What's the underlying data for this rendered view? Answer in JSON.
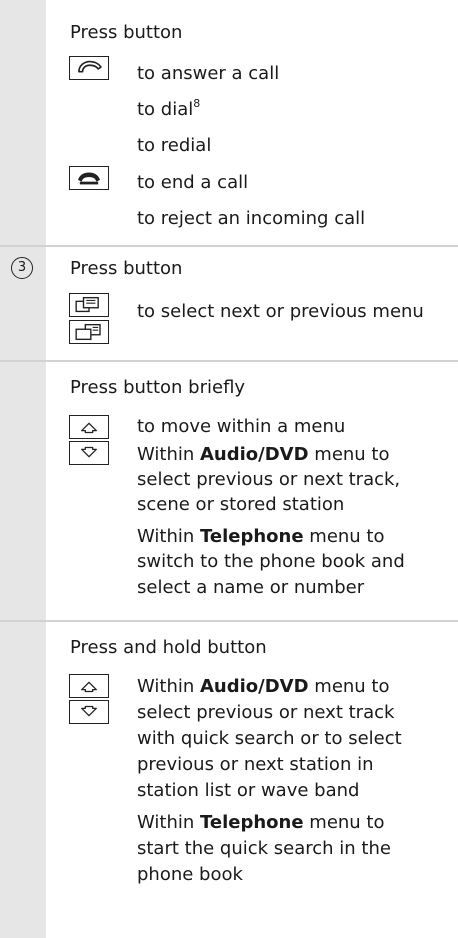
{
  "section1": {
    "heading": "Press button",
    "answer": "to answer a call",
    "dial": "to dial",
    "dial_footnote": "8",
    "redial": "to redial",
    "end": "to end a call",
    "reject": "to reject an incoming call",
    "icons": [
      "phone-answer-icon",
      "phone-hangup-icon"
    ]
  },
  "section2": {
    "number": "3",
    "heading": "Press button",
    "select_menu": "to select next or previous menu",
    "icons": [
      "menu-next-icon",
      "menu-previous-icon"
    ]
  },
  "section3": {
    "heading": "Press button briefly",
    "move": "to move within a menu",
    "audio_prefix": "Within ",
    "audio_bold": "Audio/DVD",
    "audio_suffix": " menu to",
    "audio_line2": "select previous or next track,",
    "audio_line3": "scene or stored station",
    "tel_prefix": "Within ",
    "tel_bold": "Telephone",
    "tel_suffix": " menu to",
    "tel_line2": "switch to the phone book and",
    "tel_line3": "select a name or number",
    "icons": [
      "arrow-up-icon",
      "arrow-down-icon"
    ]
  },
  "section4": {
    "heading": "Press and hold button",
    "audio_prefix": "Within ",
    "audio_bold": "Audio/DVD",
    "audio_suffix": " menu to",
    "audio_line2": "select previous or next track",
    "audio_line3": "with quick search or to select",
    "audio_line4": "previous or next station in",
    "audio_line5": "station list or wave band",
    "tel_prefix": "Within ",
    "tel_bold": "Telephone",
    "tel_suffix": " menu to",
    "tel_line2": "start the quick search in the",
    "tel_line3": "phone book",
    "icons": [
      "arrow-up-icon",
      "arrow-down-icon"
    ]
  },
  "colors": {
    "shade": "#e6e6e6",
    "separator": "#d2d2d2",
    "text": "#1a1a1a"
  }
}
